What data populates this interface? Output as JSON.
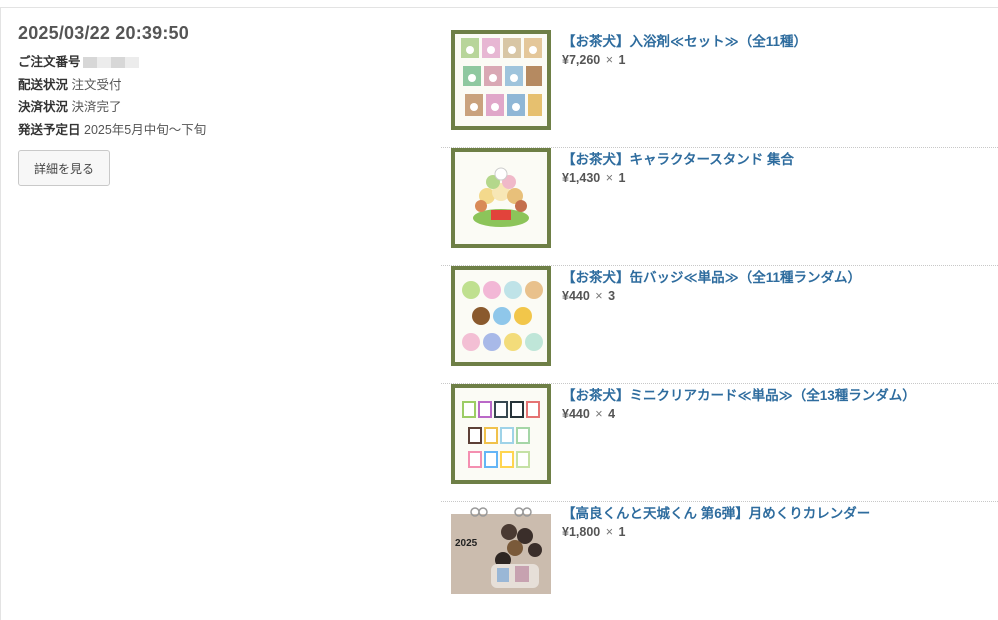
{
  "order": {
    "date": "2025/03/22 20:39:50",
    "number_label": "ご注文番号",
    "shipping_status_label": "配送状況",
    "shipping_status_value": "注文受付",
    "payment_status_label": "決済状況",
    "payment_status_value": "決済完了",
    "ship_date_label": "発送予定日",
    "ship_date_value": "2025年5月中旬〜下旬",
    "details_button": "詳細を見る"
  },
  "items": [
    {
      "title": "【お茶犬】入浴剤≪セット≫（全11種）",
      "price": "¥7,260",
      "times": "×",
      "qty": "1",
      "thumb_icon": "bath-salt-set-image"
    },
    {
      "title": "【お茶犬】キャラクタースタンド 集合",
      "price": "¥1,430",
      "times": "×",
      "qty": "1",
      "thumb_icon": "character-stand-image"
    },
    {
      "title": "【お茶犬】缶バッジ≪単品≫（全11種ランダム）",
      "price": "¥440",
      "times": "×",
      "qty": "3",
      "thumb_icon": "can-badge-image"
    },
    {
      "title": "【お茶犬】ミニクリアカード≪単品≫（全13種ランダム）",
      "price": "¥440",
      "times": "×",
      "qty": "4",
      "thumb_icon": "clear-card-image"
    },
    {
      "title": "【高良くんと天城くん 第6弾】月めくりカレンダー",
      "price": "¥1,800",
      "times": "×",
      "qty": "1",
      "thumb_icon": "calendar-image",
      "calendar_year": "2025"
    }
  ],
  "colors": {
    "link": "#2e6c9e",
    "frame": "#6e7f46"
  }
}
